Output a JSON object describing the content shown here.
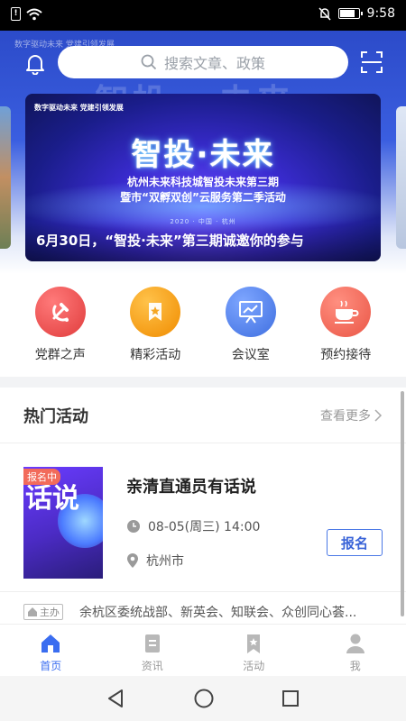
{
  "status_bar": {
    "time": "9:58",
    "battery_level": 0.85
  },
  "header": {
    "search_placeholder": "搜索文章、政策",
    "hero_bg_text": "智投 · 未来",
    "hero_small_text": "数字驱动未来 党建引领发展"
  },
  "banner": {
    "tag": "数字驱动未来 党建引领发展",
    "title": "智投·未来",
    "subtitle_1": "杭州未来科技城智投未来第三期",
    "subtitle_2": "暨市“双孵双创”云服务第二季活动",
    "date_line": "2020 · 中国 · 杭州",
    "caption": "6月30日，“智投·未来”第三期诚邀你的参与"
  },
  "menu": [
    {
      "label": "党群之声",
      "icon": "party-icon",
      "color": "#ea4b4b"
    },
    {
      "label": "精彩活动",
      "icon": "activity-icon",
      "color": "#f5a623"
    },
    {
      "label": "会议室",
      "icon": "meeting-room-icon",
      "color": "#4a7be6"
    },
    {
      "label": "预约接待",
      "icon": "tea-cup-icon",
      "color": "#f26b5b"
    }
  ],
  "hot_activities": {
    "title": "热门活动",
    "more_label": "查看更多",
    "item": {
      "badge": "报名中",
      "poster_text": "话说",
      "title": "亲清直通员有话说",
      "time": "08-05(周三)  14:00",
      "place": "杭州市",
      "signup_label": "报名"
    },
    "host": {
      "tag": "主办",
      "text": "余杭区委统战部、新英会、知联会、众创同心荟..."
    }
  },
  "tabbar": [
    {
      "label": "首页",
      "icon": "home-icon",
      "active": true
    },
    {
      "label": "资讯",
      "icon": "news-icon",
      "active": false
    },
    {
      "label": "活动",
      "icon": "activity-tab-icon",
      "active": false
    },
    {
      "label": "我",
      "icon": "profile-icon",
      "active": false
    }
  ],
  "colors": {
    "accent": "#3a6df0",
    "header_blue": "#2c4bc9"
  }
}
